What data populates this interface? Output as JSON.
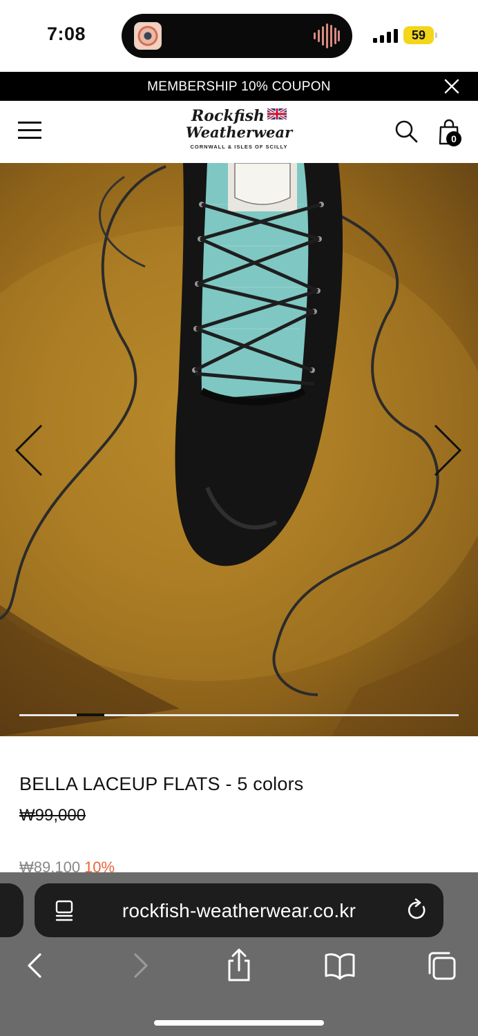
{
  "status_bar": {
    "time": "7:08",
    "battery": "59",
    "icons": [
      "album-art-icon",
      "audio-wave-icon",
      "cellular-signal-icon",
      "battery-icon"
    ]
  },
  "promo": {
    "text": "MEMBERSHIP 10% COUPON",
    "close_icon": "close-icon"
  },
  "header": {
    "logo_line1": "Rockfish",
    "logo_line2": "Weatherwear",
    "logo_sub": "CORNWALL & ISLES OF SCILLY",
    "menu_icon": "hamburger-menu-icon",
    "search_icon": "search-icon",
    "cart_icon": "shopping-bag-icon",
    "cart_count": "0"
  },
  "gallery": {
    "prev_icon": "chevron-left-icon",
    "next_icon": "chevron-right-icon",
    "progress": 0.13
  },
  "product": {
    "title": "BELLA LACEUP FLATS - 5 colors",
    "price_original": "₩99,000",
    "price_sale": "₩89,100",
    "discount": "10%"
  },
  "browser": {
    "url": "rockfish-weatherwear.co.kr",
    "page_menu_icon": "page-menu-icon",
    "reload_icon": "reload-icon",
    "toolbar": [
      "back-icon",
      "forward-icon",
      "share-icon",
      "bookmarks-icon",
      "tabs-icon"
    ]
  },
  "colors": {
    "promo_bg": "#000000",
    "discount": "#e7643a",
    "browser_bg": "#6b6b6b",
    "url_bar_bg": "#1d1d1d",
    "battery": "#f3d51a"
  }
}
